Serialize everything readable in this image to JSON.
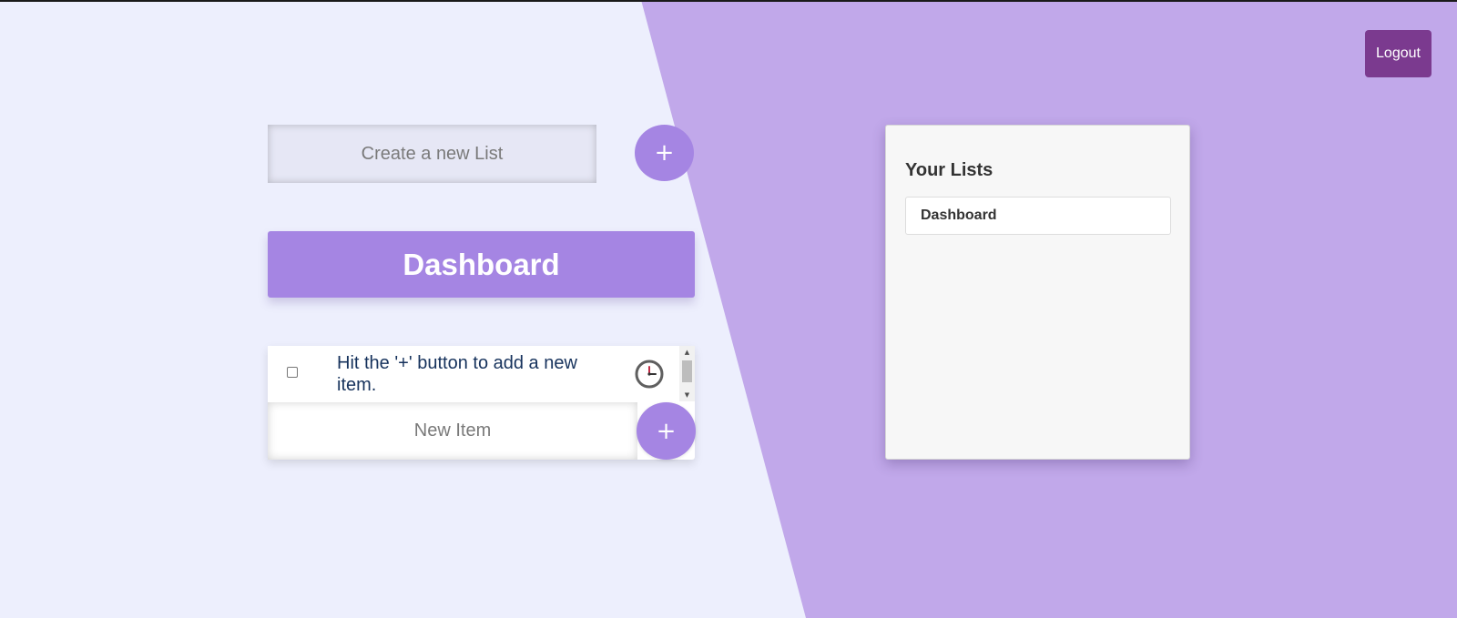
{
  "header": {
    "logout_label": "Logout"
  },
  "create_list": {
    "placeholder": "Create a new List",
    "add_symbol": "+"
  },
  "current_list": {
    "title": "Dashboard",
    "items": [
      {
        "text": "Hit the '+' button to add a new item.",
        "checked": false
      }
    ],
    "new_item_placeholder": "New Item",
    "add_symbol": "+"
  },
  "sidebar": {
    "heading": "Your Lists",
    "lists": [
      {
        "label": "Dashboard"
      }
    ]
  },
  "colors": {
    "page_background": "#edeffd",
    "diagonal_background": "#c1a8ea",
    "accent": "#a585e3",
    "logout_button": "#7b3a8f",
    "item_text": "#16325c"
  },
  "icons": {
    "add": "plus-icon",
    "item_timer": "clock-icon",
    "scroll_up": "arrow-up-icon",
    "scroll_down": "arrow-down-icon"
  }
}
